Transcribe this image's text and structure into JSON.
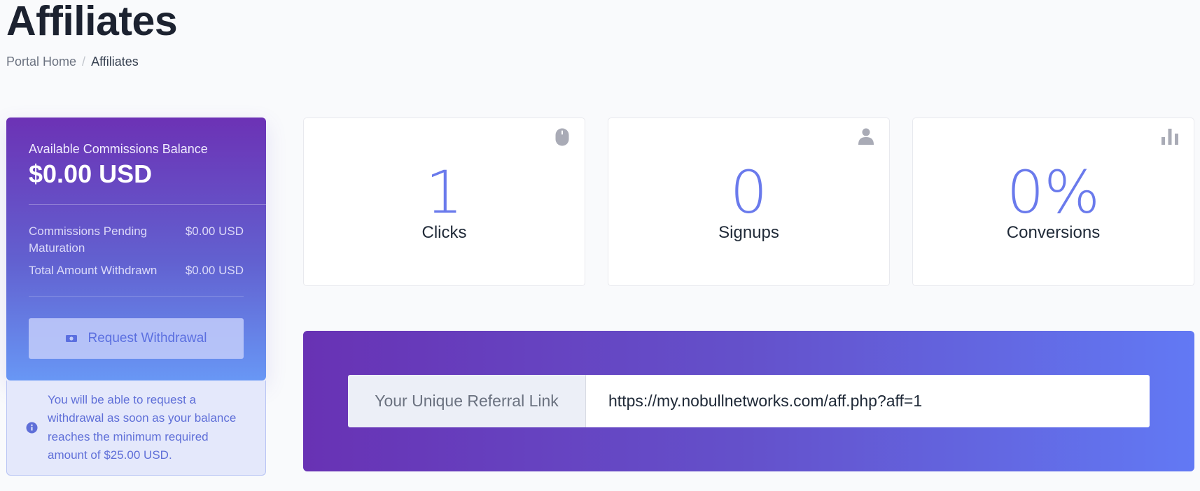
{
  "page": {
    "title": "Affiliates",
    "breadcrumb": [
      {
        "label": "Portal Home"
      },
      {
        "label": "Affiliates"
      }
    ]
  },
  "balance": {
    "available_label": "Available Commissions Balance",
    "available_value": "$0.00 USD",
    "pending_label": "Commissions Pending Maturation",
    "pending_value": "$0.00 USD",
    "withdrawn_label": "Total Amount Withdrawn",
    "withdrawn_value": "$0.00 USD",
    "withdraw_button": "Request Withdrawal",
    "button_icon": "money-bill-icon"
  },
  "info": {
    "icon": "info-circle-icon",
    "text": "You will be able to request a withdrawal as soon as your balance reaches the minimum required amount of $25.00 USD."
  },
  "stats": [
    {
      "value": "1",
      "label": "Clicks",
      "icon": "mouse-icon"
    },
    {
      "value": "0",
      "label": "Signups",
      "icon": "user-icon"
    },
    {
      "value": "0%",
      "label": "Conversions",
      "icon": "bar-chart-icon"
    }
  ],
  "referral": {
    "label": "Your Unique Referral Link",
    "link": "https://my.nobullnetworks.com/aff.php?aff=1"
  },
  "colors": {
    "accent": "#6a7aec",
    "gradient_start": "#6832b4",
    "gradient_end": "#6279f4"
  }
}
